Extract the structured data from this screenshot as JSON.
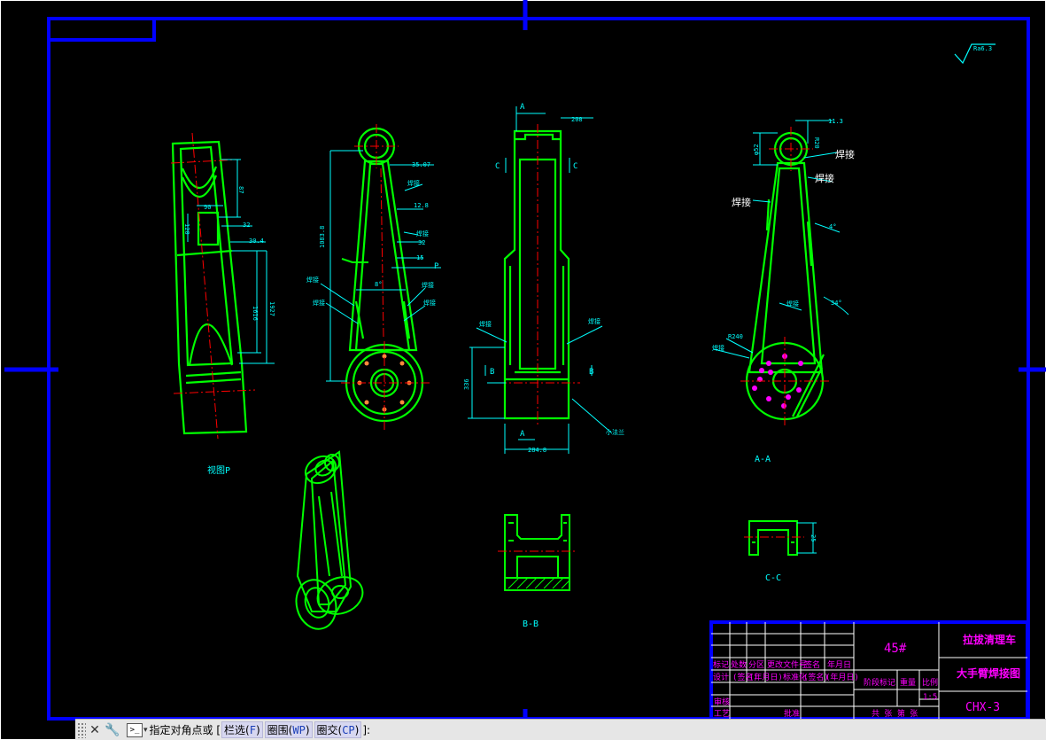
{
  "drawing": {
    "roughness": "Ra6.3",
    "weld_label": "焊接",
    "weld_label_2": "焊接",
    "dims": {
      "d_top_width": "208",
      "d_right_top": "11.3",
      "d_left_top": "φ52",
      "d_r": "R20",
      "d_left_a": "87",
      "d_90": "90",
      "d_120": "120",
      "d_32": "32",
      "d_304": "30.4",
      "d_1616": "1616",
      "d_1927": "1927",
      "d_total_height": "1083.8",
      "d_3507": "35.07",
      "d_128": "12.8",
      "d_32b": "32",
      "d_15": "15",
      "d_angle_8": "8°",
      "d_angle_4": "4°",
      "d_angle_34": "34°",
      "d_r240": "R240",
      "d_336": "336",
      "d_2848": "284.8",
      "d_25": "25"
    },
    "section_letters": {
      "a": "A",
      "c": "C",
      "b": "B",
      "p": "P"
    },
    "small_flange": "小法兰",
    "captions": {
      "view_p": "视图P",
      "aa": "A-A",
      "bb": "B-B",
      "cc": "C-C"
    }
  },
  "title_block": {
    "material": "45#",
    "company": "拉拔清理车",
    "drawing_name": "大手臂焊接图",
    "drawing_no": "CHX-3",
    "header_cells": [
      "标记",
      "处数",
      "分区",
      "更改文件号",
      "签名",
      "年月日"
    ],
    "row2_cells": [
      "设计",
      "(签名)",
      "(年月日)",
      "标准化",
      "(签名)",
      "(年月日)"
    ],
    "stage_label": "阶段标记",
    "weight_label": "重量",
    "scale_label": "比例",
    "scale_value": "1:5",
    "check_label": "审核",
    "process_label": "工艺",
    "approve_label": "批准",
    "sheet_label": "共  张  第  张"
  },
  "command_bar": {
    "close_icon": "close-icon",
    "settings_icon": "wrench-icon",
    "prompt_icon_text": ">_",
    "prompt_text": "指定对角点或 [",
    "opt_fence_label": "栏选",
    "opt_fence_key": "F",
    "opt_wpoly_label": "圈围",
    "opt_wpoly_key": "WP",
    "opt_cpoly_label": "圈交",
    "opt_cpoly_key": "CP",
    "prompt_end": "]:"
  },
  "colors": {
    "frame": "#0000ff",
    "part": "#00ff00",
    "dimension": "#00ffff",
    "title_text": "#ff00ff",
    "center_line": "#ff0000",
    "white": "#ffffff"
  }
}
